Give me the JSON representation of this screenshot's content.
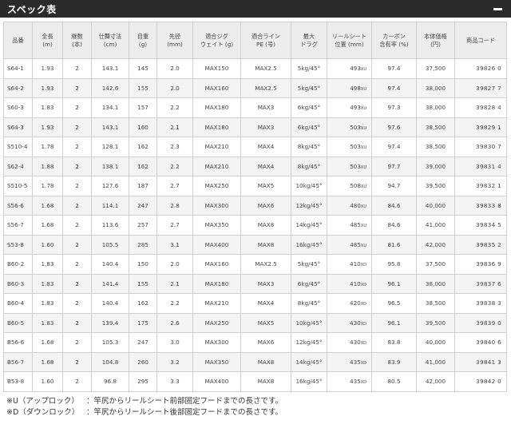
{
  "header": {
    "title": "スペック表"
  },
  "table": {
    "headers": [
      [
        "品番"
      ],
      [
        "全長",
        "(m)"
      ],
      [
        "継数",
        "(本)"
      ],
      [
        "仕舞寸法",
        "(cm)"
      ],
      [
        "自重",
        "(g)"
      ],
      [
        "先径",
        "(mm)"
      ],
      [
        "適合ジグ",
        "ウェイト (g)"
      ],
      [
        "適合ライン",
        "PE (号)"
      ],
      [
        "最大",
        "ドラグ"
      ],
      [
        "リールシート",
        "位置 (mm)"
      ],
      [
        "カーボン",
        "含有率 (%)"
      ],
      [
        "本体価格",
        "(円)"
      ],
      [
        "商品コード"
      ]
    ],
    "rows": [
      {
        "model": "S64-1",
        "len": "1.93",
        "pcs": "2",
        "closed": "143.1",
        "weight": "145",
        "tip": "2.0",
        "jig": "MAX150",
        "line": "MAX2.5",
        "drag": "5kg/45°",
        "seat": "493",
        "seat_unit": "XU",
        "carbon": "97.4",
        "price": "37,500",
        "code": "39826 0"
      },
      {
        "model": "S64-2",
        "len": "1.93",
        "pcs": "2",
        "closed": "142.6",
        "weight": "155",
        "tip": "2.0",
        "jig": "MAX160",
        "line": "MAX2.5",
        "drag": "5kg/45°",
        "seat": "498",
        "seat_unit": "XU",
        "carbon": "97.4",
        "price": "38,000",
        "code": "39827 7"
      },
      {
        "model": "S60-3",
        "len": "1.83",
        "pcs": "2",
        "closed": "134.1",
        "weight": "157",
        "tip": "2.2",
        "jig": "MAX180",
        "line": "MAX3",
        "drag": "6kg/45°",
        "seat": "493",
        "seat_unit": "XU",
        "carbon": "97.3",
        "price": "38,000",
        "code": "39828 4"
      },
      {
        "model": "S64-3",
        "len": "1.93",
        "pcs": "2",
        "closed": "143.1",
        "weight": "160",
        "tip": "2.1",
        "jig": "MAX180",
        "line": "MAX3",
        "drag": "6kg/45°",
        "seat": "503",
        "seat_unit": "XU",
        "carbon": "97.6",
        "price": "38,500",
        "code": "39829 1"
      },
      {
        "model": "S510-4",
        "len": "1.78",
        "pcs": "2",
        "closed": "128.1",
        "weight": "162",
        "tip": "2.3",
        "jig": "MAX210",
        "line": "MAX4",
        "drag": "8kg/45°",
        "seat": "503",
        "seat_unit": "XU",
        "carbon": "97.4",
        "price": "38,500",
        "code": "39830 7"
      },
      {
        "model": "S62-4",
        "len": "1.88",
        "pcs": "2",
        "closed": "138.1",
        "weight": "162",
        "tip": "2.2",
        "jig": "MAX210",
        "line": "MAX4",
        "drag": "8kg/45°",
        "seat": "503",
        "seat_unit": "XU",
        "carbon": "97.7",
        "price": "39,000",
        "code": "39831 4"
      },
      {
        "model": "S510-5",
        "len": "1.78",
        "pcs": "2",
        "closed": "127.6",
        "weight": "187",
        "tip": "2.7",
        "jig": "MAX250",
        "line": "MAX5",
        "drag": "10kg/45°",
        "seat": "508",
        "seat_unit": "XU",
        "carbon": "94.7",
        "price": "39,500",
        "code": "39832 1"
      },
      {
        "model": "S56-6",
        "len": "1.68",
        "pcs": "2",
        "closed": "114.1",
        "weight": "247",
        "tip": "2.8",
        "jig": "MAX300",
        "line": "MAX6",
        "drag": "12kg/45°",
        "seat": "480",
        "seat_unit": "XU",
        "carbon": "84.6",
        "price": "40,000",
        "code": "39833 8"
      },
      {
        "model": "S56-7",
        "len": "1.68",
        "pcs": "2",
        "closed": "113.6",
        "weight": "257",
        "tip": "2.7",
        "jig": "MAX350",
        "line": "MAX8",
        "drag": "14kg/45°",
        "seat": "485",
        "seat_unit": "XU",
        "carbon": "84.6",
        "price": "41,000",
        "code": "39834 5"
      },
      {
        "model": "S53-8",
        "len": "1.60",
        "pcs": "2",
        "closed": "105.5",
        "weight": "285",
        "tip": "3.1",
        "jig": "MAX400",
        "line": "MAX8",
        "drag": "16kg/45°",
        "seat": "485",
        "seat_unit": "XU",
        "carbon": "81.6",
        "price": "42,000",
        "code": "39835 2"
      },
      {
        "model": "B60-2",
        "len": "1.83",
        "pcs": "2",
        "closed": "140.4",
        "weight": "150",
        "tip": "2.0",
        "jig": "MAX160",
        "line": "MAX2.5",
        "drag": "5kg/45°",
        "seat": "410",
        "seat_unit": "XD",
        "carbon": "95.8",
        "price": "37,500",
        "code": "39836 9"
      },
      {
        "model": "B60-3",
        "len": "1.83",
        "pcs": "2",
        "closed": "141.4",
        "weight": "155",
        "tip": "2.1",
        "jig": "MAX180",
        "line": "MAX3",
        "drag": "6kg/45°",
        "seat": "410",
        "seat_unit": "XD",
        "carbon": "96.1",
        "price": "38,000",
        "code": "39837 6"
      },
      {
        "model": "B60-4",
        "len": "1.83",
        "pcs": "2",
        "closed": "140.4",
        "weight": "162",
        "tip": "2.2",
        "jig": "MAX210",
        "line": "MAX4",
        "drag": "8kg/45°",
        "seat": "420",
        "seat_unit": "XD",
        "carbon": "96.5",
        "price": "38,500",
        "code": "39838 3"
      },
      {
        "model": "B60-5",
        "len": "1.83",
        "pcs": "2",
        "closed": "139.4",
        "weight": "175",
        "tip": "2.6",
        "jig": "MAX250",
        "line": "MAX5",
        "drag": "10kg/45°",
        "seat": "430",
        "seat_unit": "XD",
        "carbon": "96.1",
        "price": "39,500",
        "code": "39839 0"
      },
      {
        "model": "B56-6",
        "len": "1.68",
        "pcs": "2",
        "closed": "105.3",
        "weight": "247",
        "tip": "3.0",
        "jig": "MAX300",
        "line": "MAX6",
        "drag": "12kg/45°",
        "seat": "430",
        "seat_unit": "XD",
        "carbon": "83.8",
        "price": "40,000",
        "code": "39840 6"
      },
      {
        "model": "B56-7",
        "len": "1.68",
        "pcs": "2",
        "closed": "104.8",
        "weight": "260",
        "tip": "3.2",
        "jig": "MAX350",
        "line": "MAX8",
        "drag": "14kg/45°",
        "seat": "435",
        "seat_unit": "XD",
        "carbon": "83.9",
        "price": "41,000",
        "code": "39841 3"
      },
      {
        "model": "B53-8",
        "len": "1.60",
        "pcs": "2",
        "closed": "96.8",
        "weight": "295",
        "tip": "3.3",
        "jig": "MAX400",
        "line": "MAX8",
        "drag": "16kg/45°",
        "seat": "435",
        "seat_unit": "XD",
        "carbon": "80.5",
        "price": "42,000",
        "code": "39842 0"
      }
    ]
  },
  "notes": [
    {
      "label": "※U（アップロック）",
      "text": "：竿尻からリールシート前部固定フードまでの長さです。"
    },
    {
      "label": "※D（ダウンロック）",
      "text": "：竿尻からリールシート後部固定フードまでの長さです。"
    }
  ]
}
